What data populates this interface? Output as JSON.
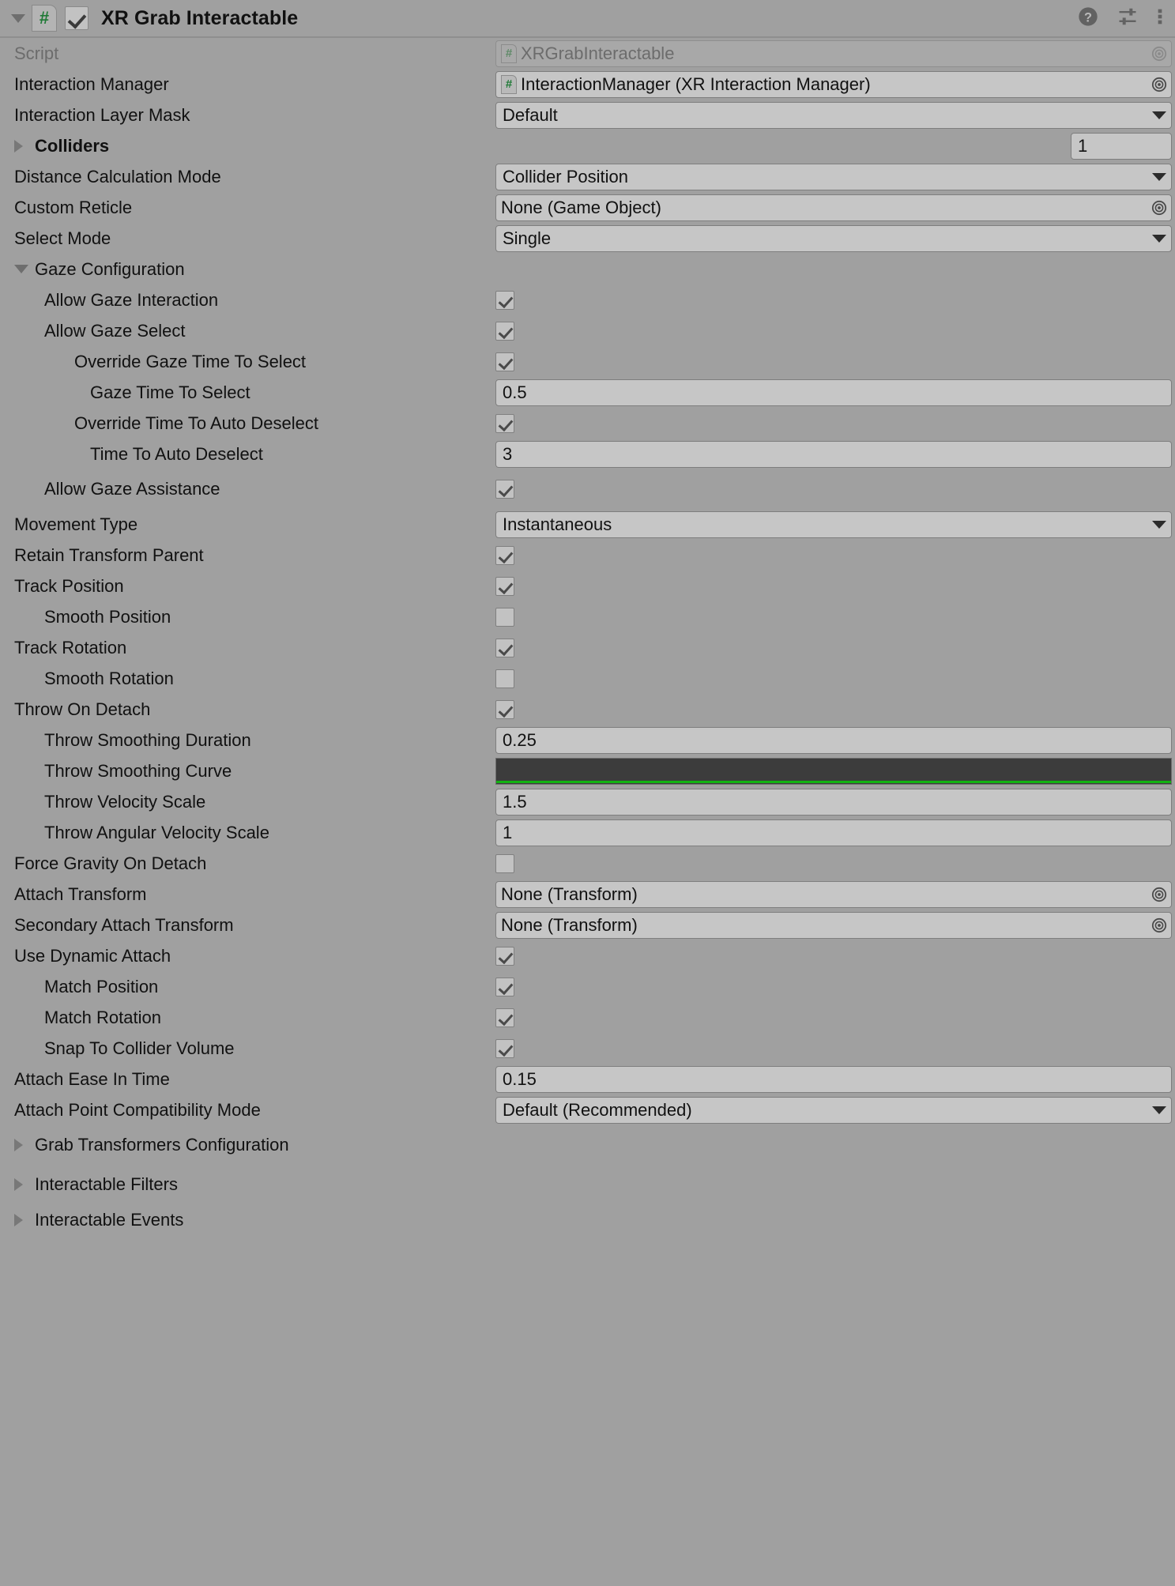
{
  "header": {
    "title": "XR Grab Interactable",
    "foldout_icon": "triangle-down-icon",
    "script_badge": "#",
    "enabled": true,
    "icons": [
      "help-icon",
      "preset-icon",
      "more-menu-icon"
    ]
  },
  "accent": {
    "background": "#a0a0a0",
    "field": "#c6c6c6",
    "text": "#111111",
    "disabled_text": "#6c6c6c",
    "script_green": "#1f7a36",
    "curve_line": "#12b312"
  },
  "rows": [
    {
      "label": "Script",
      "indent": 0,
      "kind": "object",
      "value": "XRGrabInteractable",
      "badge": "#",
      "disabled": true
    },
    {
      "label": "Interaction Manager",
      "indent": 0,
      "kind": "object",
      "value": "InteractionManager (XR Interaction Manager)",
      "badge": "#",
      "disabled": false
    },
    {
      "label": "Interaction Layer Mask",
      "indent": 0,
      "kind": "dropdown",
      "value": "Default"
    },
    {
      "label": "Colliders",
      "indent": 0,
      "kind": "foldout-count",
      "bold": true,
      "foldout": "collapsed",
      "value": "1"
    },
    {
      "label": "Distance Calculation Mode",
      "indent": 0,
      "kind": "dropdown",
      "value": "Collider Position"
    },
    {
      "label": "Custom Reticle",
      "indent": 0,
      "kind": "object",
      "value": "None (Game Object)",
      "badge": "",
      "disabled": false
    },
    {
      "label": "Select Mode",
      "indent": 0,
      "kind": "dropdown",
      "value": "Single"
    },
    {
      "label": "Gaze Configuration",
      "indent": 0,
      "kind": "foldout",
      "foldout": "expanded"
    },
    {
      "label": "Allow Gaze Interaction",
      "indent": 1,
      "kind": "checkbox",
      "value": true
    },
    {
      "label": "Allow Gaze Select",
      "indent": 1,
      "kind": "checkbox",
      "value": true
    },
    {
      "label": "Override Gaze Time To Select",
      "indent": 2,
      "kind": "checkbox",
      "value": true
    },
    {
      "label": "Gaze Time To Select",
      "indent": 3,
      "kind": "text",
      "value": "0.5"
    },
    {
      "label": "Override Time To Auto Deselect",
      "indent": 2,
      "kind": "checkbox",
      "value": true
    },
    {
      "label": "Time To Auto Deselect",
      "indent": 3,
      "kind": "text",
      "value": "3"
    },
    {
      "label": "Allow Gaze Assistance",
      "indent": 1,
      "kind": "checkbox",
      "value": true,
      "spacer_after": true
    },
    {
      "label": "Movement Type",
      "indent": 0,
      "kind": "dropdown",
      "value": "Instantaneous"
    },
    {
      "label": "Retain Transform Parent",
      "indent": 0,
      "kind": "checkbox",
      "value": true
    },
    {
      "label": "Track Position",
      "indent": 0,
      "kind": "checkbox",
      "value": true
    },
    {
      "label": "Smooth Position",
      "indent": 1,
      "kind": "checkbox",
      "value": false
    },
    {
      "label": "Track Rotation",
      "indent": 0,
      "kind": "checkbox",
      "value": true
    },
    {
      "label": "Smooth Rotation",
      "indent": 1,
      "kind": "checkbox",
      "value": false
    },
    {
      "label": "Throw On Detach",
      "indent": 0,
      "kind": "checkbox",
      "value": true
    },
    {
      "label": "Throw Smoothing Duration",
      "indent": 1,
      "kind": "text",
      "value": "0.25"
    },
    {
      "label": "Throw Smoothing Curve",
      "indent": 1,
      "kind": "curve",
      "value": ""
    },
    {
      "label": "Throw Velocity Scale",
      "indent": 1,
      "kind": "text",
      "value": "1.5"
    },
    {
      "label": "Throw Angular Velocity Scale",
      "indent": 1,
      "kind": "text",
      "value": "1"
    },
    {
      "label": "Force Gravity On Detach",
      "indent": 0,
      "kind": "checkbox",
      "value": false
    },
    {
      "label": "Attach Transform",
      "indent": 0,
      "kind": "object",
      "value": "None (Transform)",
      "badge": "",
      "disabled": false
    },
    {
      "label": "Secondary Attach Transform",
      "indent": 0,
      "kind": "object",
      "value": "None (Transform)",
      "badge": "",
      "disabled": false
    },
    {
      "label": "Use Dynamic Attach",
      "indent": 0,
      "kind": "checkbox",
      "value": true
    },
    {
      "label": "Match Position",
      "indent": 1,
      "kind": "checkbox",
      "value": true
    },
    {
      "label": "Match Rotation",
      "indent": 1,
      "kind": "checkbox",
      "value": true
    },
    {
      "label": "Snap To Collider Volume",
      "indent": 1,
      "kind": "checkbox",
      "value": true
    },
    {
      "label": "Attach Ease In Time",
      "indent": 0,
      "kind": "text",
      "value": "0.15"
    },
    {
      "label": "Attach Point Compatibility Mode",
      "indent": 0,
      "kind": "dropdown",
      "value": "Default (Recommended)"
    },
    {
      "label": "Grab Transformers Configuration",
      "indent": 0,
      "kind": "foldout",
      "foldout": "collapsed",
      "spacer_after": true
    },
    {
      "label": "Interactable Filters",
      "indent": 0,
      "kind": "foldout",
      "foldout": "collapsed",
      "spacer_after": true
    },
    {
      "label": "Interactable Events",
      "indent": 0,
      "kind": "foldout",
      "foldout": "collapsed"
    }
  ]
}
